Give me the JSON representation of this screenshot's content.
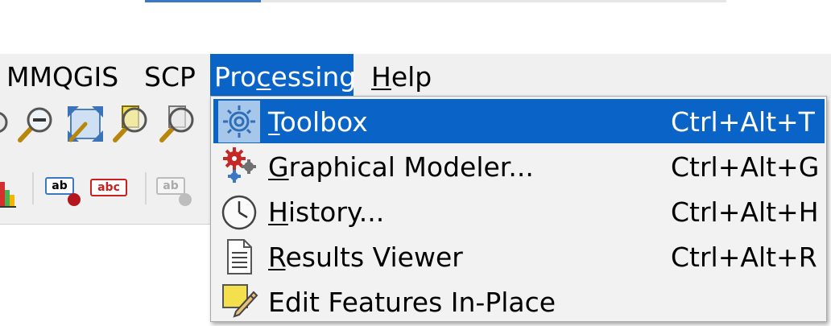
{
  "menubar": {
    "items": [
      {
        "label": "MMQGIS"
      },
      {
        "label": "SCP"
      },
      {
        "pre": "Pro",
        "mnemonic": "c",
        "post": "essing"
      },
      {
        "pre": "",
        "mnemonic": "H",
        "post": "elp"
      }
    ]
  },
  "toolbar": {
    "tool_labels": [
      "ab",
      "abc",
      "ab"
    ]
  },
  "dropdown": {
    "items": [
      {
        "mnemonic": "T",
        "rest": "oolbox",
        "shortcut": "Ctrl+Alt+T",
        "icon": "gear-icon"
      },
      {
        "mnemonic": "G",
        "rest": "raphical Modeler...",
        "shortcut": "Ctrl+Alt+G",
        "icon": "modeler-gears-icon"
      },
      {
        "mnemonic": "H",
        "rest": "istory...",
        "shortcut": "Ctrl+Alt+H",
        "icon": "clock-icon"
      },
      {
        "mnemonic": "R",
        "rest": "esults Viewer",
        "shortcut": "Ctrl+Alt+R",
        "icon": "document-icon"
      },
      {
        "label": "Edit Features In-Place",
        "shortcut": "",
        "icon": "edit-in-place-icon"
      }
    ]
  },
  "colors": {
    "accent": "#0a64c8",
    "menubar_bg": "#f0f0f0",
    "icon_highlight": "#a7c7ea"
  }
}
